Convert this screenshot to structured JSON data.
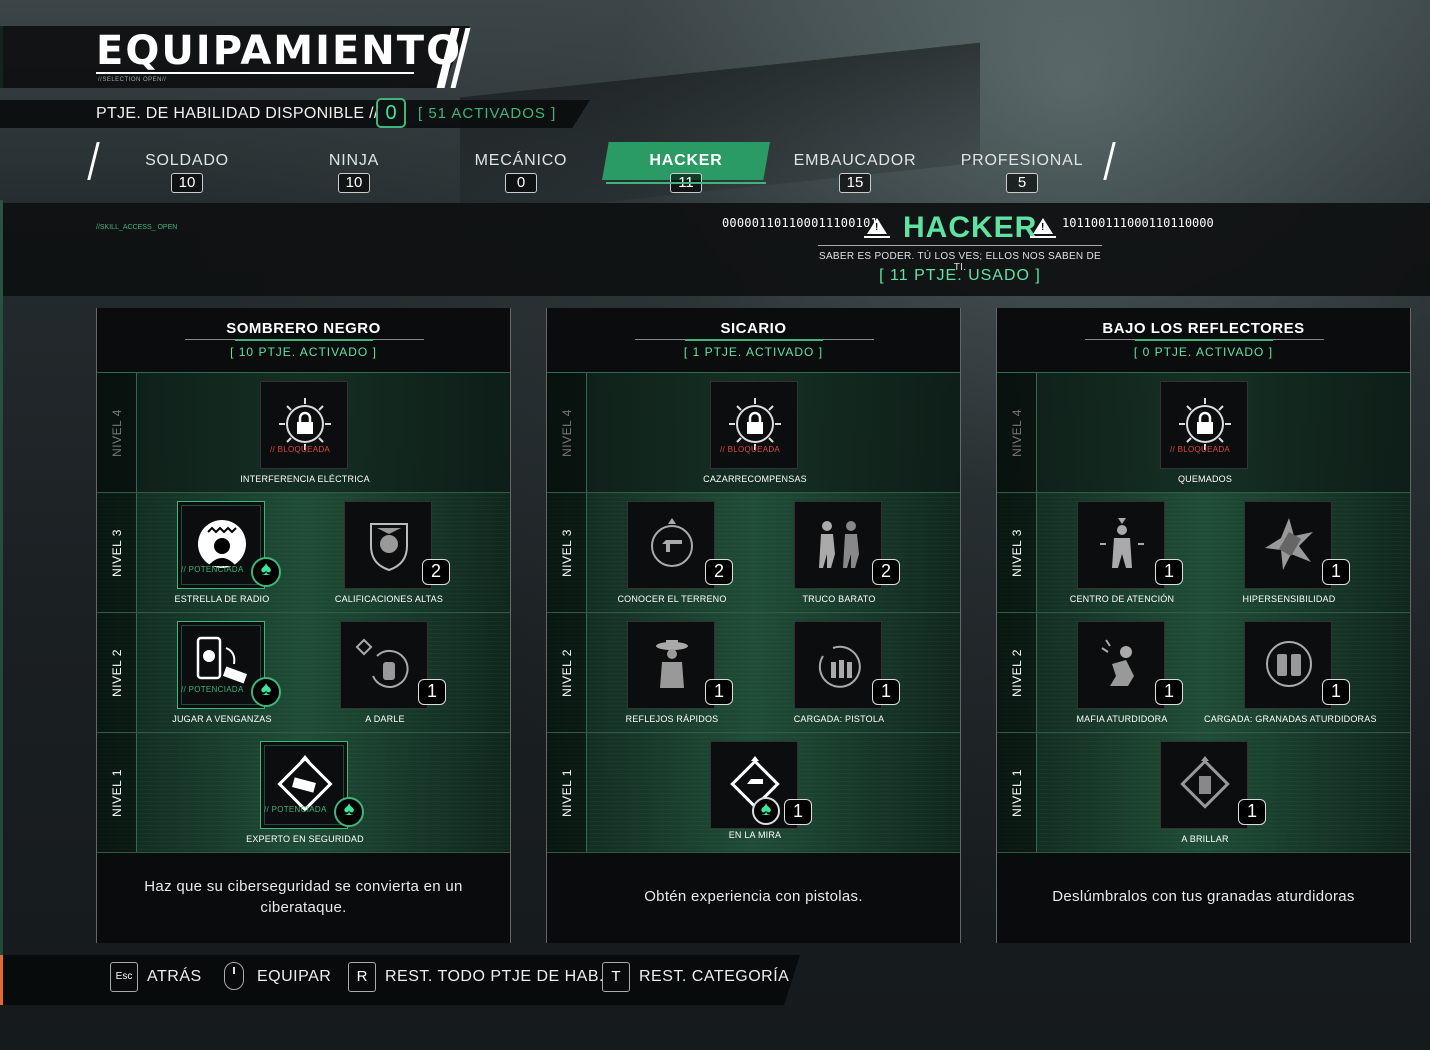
{
  "header": {
    "title": "EQUIPAMIENTO",
    "subtag": "//SELECTION OPEN//",
    "points_label": "PTJE. DE HABILIDAD DISPONIBLE //",
    "points_available": "0",
    "activated": "[ 51 ACTIVADOS ]"
  },
  "tabs": [
    {
      "label": "SOLDADO",
      "count": "10"
    },
    {
      "label": "NINJA",
      "count": "10"
    },
    {
      "label": "MECÁNICO",
      "count": "0"
    },
    {
      "label": "HACKER",
      "count": "11"
    },
    {
      "label": "EMBAUCADOR",
      "count": "15"
    },
    {
      "label": "PROFESIONAL",
      "count": "5"
    }
  ],
  "category": {
    "tag": "//SKILL_ACCESS_ OPEN",
    "binary_left": "000001101100011100101",
    "binary_right": "101100111000110110000",
    "name": "HACKER",
    "tagline": "SABER ES PODER. TÚ LOS VES; ELLOS NOS SABEN DE TI.",
    "used": "[ 11 PTJE. USADO ]"
  },
  "row_labels": [
    "NIVEL 4",
    "NIVEL 3",
    "NIVEL 2",
    "NIVEL 1"
  ],
  "panels": [
    {
      "title": "SOMBRERO NEGRO",
      "points": "[ 10 PTJE. ACTIVADO ]",
      "description": "Haz que su ciberseguridad se convierta en un ciberataque.",
      "skills": {
        "n4": {
          "name": "INTERFERENCIA ELÉCTRICA",
          "status": "// BLOQUEADA",
          "icon": "lock-icon"
        },
        "n3a": {
          "name": "ESTRELLA DE RADIO",
          "status": "// POTENCIADA",
          "icon": "radio-star-icon"
        },
        "n3b": {
          "name": "CALIFICACIONES ALTAS",
          "level": "2",
          "icon": "officer-badge-icon"
        },
        "n2a": {
          "name": "JUGAR A VENGANZAS",
          "status": "// POTENCIADA",
          "icon": "phone-skull-icon"
        },
        "n2b": {
          "name": "A DARLE",
          "level": "1",
          "icon": "grenade-spin-icon"
        },
        "n1": {
          "name": "EXPERTO EN SEGURIDAD",
          "status": "// POTENCIADA",
          "icon": "security-camera-icon"
        }
      }
    },
    {
      "title": "SICARIO",
      "points": "[ 1 PTJE. ACTIVADO ]",
      "description": "Obtén experiencia con pistolas.",
      "skills": {
        "n4": {
          "name": "CAZARRECOMPENSAS",
          "status": "// BLOQUEADA",
          "icon": "lock-icon"
        },
        "n3a": {
          "name": "CONOCER EL TERRENO",
          "level": "2",
          "icon": "pistol-circle-icon"
        },
        "n3b": {
          "name": "TRUCO BARATO",
          "level": "2",
          "icon": "fighters-icon"
        },
        "n2a": {
          "name": "REFLEJOS RÁPIDOS",
          "level": "1",
          "icon": "gunslinger-icon"
        },
        "n2b": {
          "name": "CARGADA: PISTOLA",
          "level": "1",
          "icon": "ammo-reload-icon"
        },
        "n1": {
          "name": "EN LA MIRA",
          "level": "1",
          "icon": "pistol-diamond-icon"
        }
      }
    },
    {
      "title": "BAJO LOS REFLECTORES",
      "points": "[ 0 PTJE. ACTIVADO ]",
      "description": "Deslúmbralos con tus granadas aturdidoras",
      "skills": {
        "n4": {
          "name": "QUEMADOS",
          "status": "// BLOQUEADA",
          "icon": "lock-icon"
        },
        "n3a": {
          "name": "CENTRO DE ATENCIÓN",
          "level": "1",
          "icon": "spotlight-person-icon"
        },
        "n3b": {
          "name": "HIPERSENSIBILIDAD",
          "level": "1",
          "icon": "flash-burst-icon"
        },
        "n2a": {
          "name": "MAFIA ATURDIDORA",
          "level": "1",
          "icon": "stunned-person-icon"
        },
        "n2b": {
          "name": "CARGADA: GRANADAS ATURDIDORAS",
          "level": "1",
          "icon": "grenade-reload-icon"
        },
        "n1": {
          "name": "A BRILLAR",
          "level": "1",
          "icon": "flashbang-diamond-icon"
        }
      }
    }
  ],
  "footer": {
    "back_key": "Esc",
    "back": "ATRÁS",
    "equip": "EQUIPAR",
    "reset_all_key": "R",
    "reset_all": "REST. TODO PTJE DE HAB.",
    "reset_cat_key": "T",
    "reset_cat": "REST. CATEGORÍA"
  },
  "colors": {
    "accent": "#3fb57c",
    "accent_bright": "#5fe3a3",
    "locked": "#e04848",
    "warning": "#e36a2e"
  }
}
